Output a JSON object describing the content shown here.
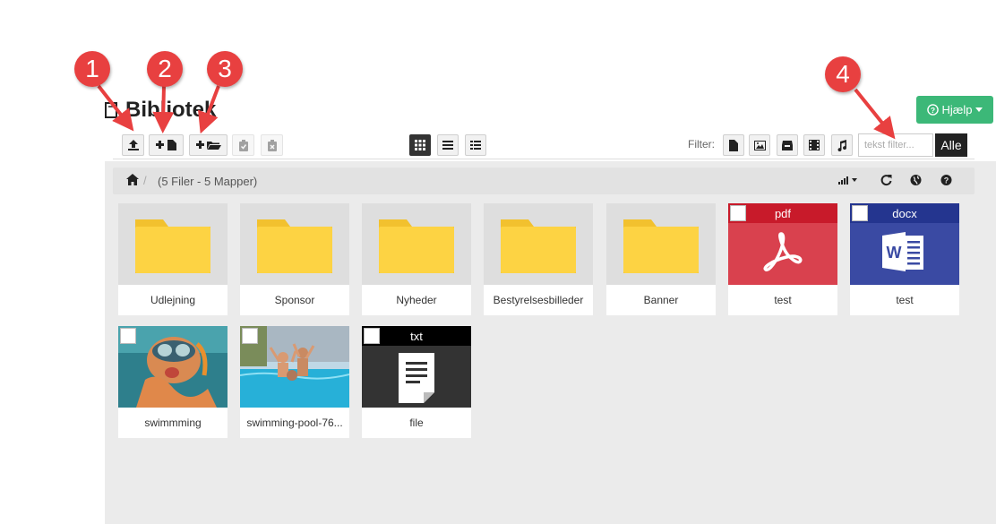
{
  "header": {
    "title": "Bibliotek"
  },
  "help": {
    "label": "Hjælp"
  },
  "toolbar": {
    "buttons": [
      {
        "icon": "upload-icon"
      },
      {
        "icon": "new-file-icon"
      },
      {
        "icon": "new-folder-icon"
      },
      {
        "icon": "paste-icon"
      },
      {
        "icon": "delete-clipboard-icon"
      }
    ],
    "views": [
      "grid-view-icon",
      "list-view-icon",
      "details-view-icon"
    ],
    "filter_label": "Filter:",
    "filters": [
      "document-icon",
      "image-icon",
      "archive-icon",
      "video-icon",
      "audio-icon"
    ],
    "search_placeholder": "tekst filter...",
    "alle_label": "Alle"
  },
  "breadcrumb": {
    "separator": "/",
    "summary": "(5 Filer - 5 Mapper)"
  },
  "items": [
    {
      "label": "Udlejning",
      "kind": "folder"
    },
    {
      "label": "Sponsor",
      "kind": "folder"
    },
    {
      "label": "Nyheder",
      "kind": "folder"
    },
    {
      "label": "Bestyrelsesbilleder",
      "kind": "folder"
    },
    {
      "label": "Banner",
      "kind": "folder"
    },
    {
      "label": "test",
      "kind": "file",
      "type": "pdf",
      "color": "#d9414e"
    },
    {
      "label": "test",
      "kind": "file",
      "type": "docx",
      "color": "#3a4aa3"
    },
    {
      "label": "swimmming",
      "kind": "image"
    },
    {
      "label": "swimming-pool-76...",
      "kind": "image"
    },
    {
      "label": "file",
      "kind": "file",
      "type": "txt",
      "color": "#333333"
    }
  ],
  "annotations": [
    "1",
    "2",
    "3",
    "4"
  ],
  "colors": {
    "annotation": "#e84040",
    "help": "#3cb878",
    "folder": "#fdd343"
  }
}
